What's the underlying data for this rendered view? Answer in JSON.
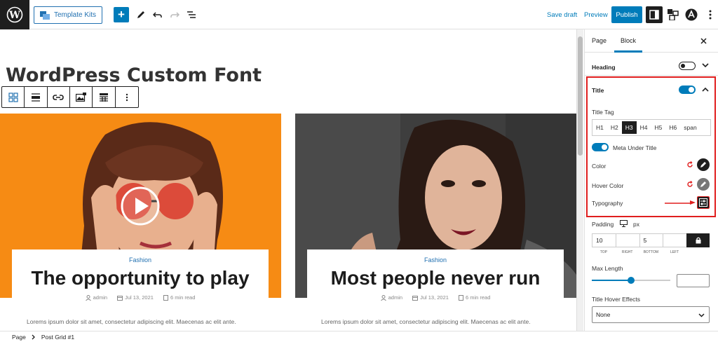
{
  "toolbar": {
    "template_kits_label": "Template Kits",
    "save_draft_label": "Save draft",
    "preview_label": "Preview",
    "publish_label": "Publish"
  },
  "canvas": {
    "page_title": "WordPress Custom Font",
    "cards": [
      {
        "category": "Fashion",
        "title": "The opportunity to play",
        "author": "admin",
        "date": "Jul 13, 2021",
        "read_time": "6 min read",
        "excerpt": "Lorems ipsum dolor sit amet, consectetur adipiscing elit. Maecenas ac elit ante."
      },
      {
        "category": "Fashion",
        "title": "Most people never run",
        "author": "admin",
        "date": "Jul 13, 2021",
        "read_time": "6 min read",
        "excerpt": "Lorems ipsum dolor sit amet, consectetur adipiscing elit. Maecenas ac elit ante."
      }
    ]
  },
  "sidebar": {
    "tabs": [
      "Page",
      "Block"
    ],
    "active_tab": "Block",
    "heading_label": "Heading",
    "heading_enabled": false,
    "title_label": "Title",
    "title_enabled": true,
    "title_tag_label": "Title Tag",
    "title_tags": [
      "H1",
      "H2",
      "H3",
      "H4",
      "H5",
      "H6",
      "span"
    ],
    "title_tag_selected": "H3",
    "meta_under_title_label": "Meta Under Title",
    "meta_under_title_enabled": true,
    "color_label": "Color",
    "hover_color_label": "Hover Color",
    "typography_label": "Typography",
    "padding_label": "Padding",
    "padding_unit": "px",
    "padding_values": [
      "10",
      "",
      "5",
      ""
    ],
    "padding_sides": [
      "TOP",
      "RIGHT",
      "BOTTOM",
      "LEFT"
    ],
    "max_length_label": "Max Length",
    "max_length_value_fraction": 0.5,
    "title_hover_effects_label": "Title Hover Effects",
    "title_hover_effects_value": "None"
  },
  "footer": {
    "breadcrumb": [
      "Page",
      "Post Grid #1"
    ]
  },
  "colors": {
    "accent": "#007cba",
    "highlight": "#e01e1e",
    "card1_bg": "#f68b14"
  }
}
